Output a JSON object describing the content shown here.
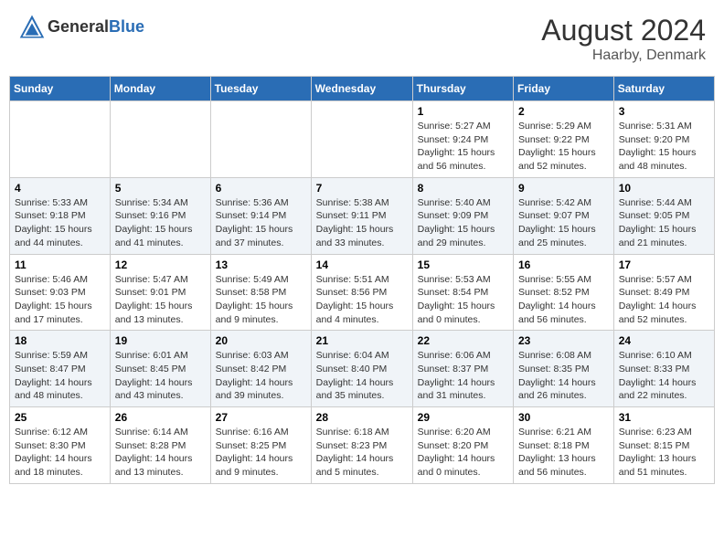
{
  "header": {
    "logo_general": "General",
    "logo_blue": "Blue",
    "month_year": "August 2024",
    "location": "Haarby, Denmark"
  },
  "days_of_week": [
    "Sunday",
    "Monday",
    "Tuesday",
    "Wednesday",
    "Thursday",
    "Friday",
    "Saturday"
  ],
  "weeks": [
    [
      {
        "day": "",
        "sunrise": "",
        "sunset": "",
        "daylight": ""
      },
      {
        "day": "",
        "sunrise": "",
        "sunset": "",
        "daylight": ""
      },
      {
        "day": "",
        "sunrise": "",
        "sunset": "",
        "daylight": ""
      },
      {
        "day": "",
        "sunrise": "",
        "sunset": "",
        "daylight": ""
      },
      {
        "day": "1",
        "sunrise": "Sunrise: 5:27 AM",
        "sunset": "Sunset: 9:24 PM",
        "daylight": "Daylight: 15 hours and 56 minutes."
      },
      {
        "day": "2",
        "sunrise": "Sunrise: 5:29 AM",
        "sunset": "Sunset: 9:22 PM",
        "daylight": "Daylight: 15 hours and 52 minutes."
      },
      {
        "day": "3",
        "sunrise": "Sunrise: 5:31 AM",
        "sunset": "Sunset: 9:20 PM",
        "daylight": "Daylight: 15 hours and 48 minutes."
      }
    ],
    [
      {
        "day": "4",
        "sunrise": "Sunrise: 5:33 AM",
        "sunset": "Sunset: 9:18 PM",
        "daylight": "Daylight: 15 hours and 44 minutes."
      },
      {
        "day": "5",
        "sunrise": "Sunrise: 5:34 AM",
        "sunset": "Sunset: 9:16 PM",
        "daylight": "Daylight: 15 hours and 41 minutes."
      },
      {
        "day": "6",
        "sunrise": "Sunrise: 5:36 AM",
        "sunset": "Sunset: 9:14 PM",
        "daylight": "Daylight: 15 hours and 37 minutes."
      },
      {
        "day": "7",
        "sunrise": "Sunrise: 5:38 AM",
        "sunset": "Sunset: 9:11 PM",
        "daylight": "Daylight: 15 hours and 33 minutes."
      },
      {
        "day": "8",
        "sunrise": "Sunrise: 5:40 AM",
        "sunset": "Sunset: 9:09 PM",
        "daylight": "Daylight: 15 hours and 29 minutes."
      },
      {
        "day": "9",
        "sunrise": "Sunrise: 5:42 AM",
        "sunset": "Sunset: 9:07 PM",
        "daylight": "Daylight: 15 hours and 25 minutes."
      },
      {
        "day": "10",
        "sunrise": "Sunrise: 5:44 AM",
        "sunset": "Sunset: 9:05 PM",
        "daylight": "Daylight: 15 hours and 21 minutes."
      }
    ],
    [
      {
        "day": "11",
        "sunrise": "Sunrise: 5:46 AM",
        "sunset": "Sunset: 9:03 PM",
        "daylight": "Daylight: 15 hours and 17 minutes."
      },
      {
        "day": "12",
        "sunrise": "Sunrise: 5:47 AM",
        "sunset": "Sunset: 9:01 PM",
        "daylight": "Daylight: 15 hours and 13 minutes."
      },
      {
        "day": "13",
        "sunrise": "Sunrise: 5:49 AM",
        "sunset": "Sunset: 8:58 PM",
        "daylight": "Daylight: 15 hours and 9 minutes."
      },
      {
        "day": "14",
        "sunrise": "Sunrise: 5:51 AM",
        "sunset": "Sunset: 8:56 PM",
        "daylight": "Daylight: 15 hours and 4 minutes."
      },
      {
        "day": "15",
        "sunrise": "Sunrise: 5:53 AM",
        "sunset": "Sunset: 8:54 PM",
        "daylight": "Daylight: 15 hours and 0 minutes."
      },
      {
        "day": "16",
        "sunrise": "Sunrise: 5:55 AM",
        "sunset": "Sunset: 8:52 PM",
        "daylight": "Daylight: 14 hours and 56 minutes."
      },
      {
        "day": "17",
        "sunrise": "Sunrise: 5:57 AM",
        "sunset": "Sunset: 8:49 PM",
        "daylight": "Daylight: 14 hours and 52 minutes."
      }
    ],
    [
      {
        "day": "18",
        "sunrise": "Sunrise: 5:59 AM",
        "sunset": "Sunset: 8:47 PM",
        "daylight": "Daylight: 14 hours and 48 minutes."
      },
      {
        "day": "19",
        "sunrise": "Sunrise: 6:01 AM",
        "sunset": "Sunset: 8:45 PM",
        "daylight": "Daylight: 14 hours and 43 minutes."
      },
      {
        "day": "20",
        "sunrise": "Sunrise: 6:03 AM",
        "sunset": "Sunset: 8:42 PM",
        "daylight": "Daylight: 14 hours and 39 minutes."
      },
      {
        "day": "21",
        "sunrise": "Sunrise: 6:04 AM",
        "sunset": "Sunset: 8:40 PM",
        "daylight": "Daylight: 14 hours and 35 minutes."
      },
      {
        "day": "22",
        "sunrise": "Sunrise: 6:06 AM",
        "sunset": "Sunset: 8:37 PM",
        "daylight": "Daylight: 14 hours and 31 minutes."
      },
      {
        "day": "23",
        "sunrise": "Sunrise: 6:08 AM",
        "sunset": "Sunset: 8:35 PM",
        "daylight": "Daylight: 14 hours and 26 minutes."
      },
      {
        "day": "24",
        "sunrise": "Sunrise: 6:10 AM",
        "sunset": "Sunset: 8:33 PM",
        "daylight": "Daylight: 14 hours and 22 minutes."
      }
    ],
    [
      {
        "day": "25",
        "sunrise": "Sunrise: 6:12 AM",
        "sunset": "Sunset: 8:30 PM",
        "daylight": "Daylight: 14 hours and 18 minutes."
      },
      {
        "day": "26",
        "sunrise": "Sunrise: 6:14 AM",
        "sunset": "Sunset: 8:28 PM",
        "daylight": "Daylight: 14 hours and 13 minutes."
      },
      {
        "day": "27",
        "sunrise": "Sunrise: 6:16 AM",
        "sunset": "Sunset: 8:25 PM",
        "daylight": "Daylight: 14 hours and 9 minutes."
      },
      {
        "day": "28",
        "sunrise": "Sunrise: 6:18 AM",
        "sunset": "Sunset: 8:23 PM",
        "daylight": "Daylight: 14 hours and 5 minutes."
      },
      {
        "day": "29",
        "sunrise": "Sunrise: 6:20 AM",
        "sunset": "Sunset: 8:20 PM",
        "daylight": "Daylight: 14 hours and 0 minutes."
      },
      {
        "day": "30",
        "sunrise": "Sunrise: 6:21 AM",
        "sunset": "Sunset: 8:18 PM",
        "daylight": "Daylight: 13 hours and 56 minutes."
      },
      {
        "day": "31",
        "sunrise": "Sunrise: 6:23 AM",
        "sunset": "Sunset: 8:15 PM",
        "daylight": "Daylight: 13 hours and 51 minutes."
      }
    ]
  ]
}
